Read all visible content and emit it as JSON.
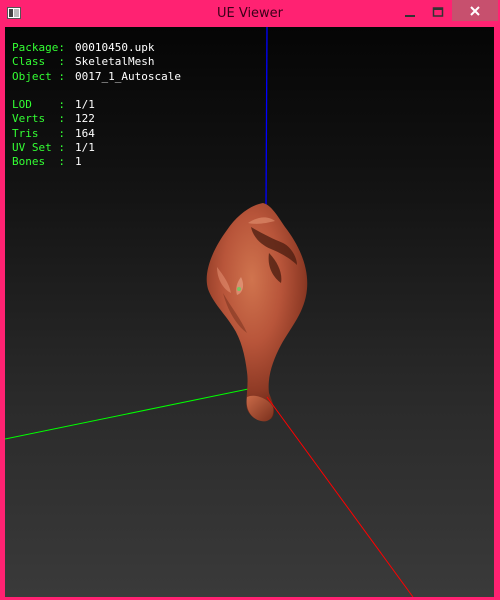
{
  "window": {
    "title": "UE Viewer",
    "colors": {
      "frame": "#ff2272",
      "close_button": "#c7506e"
    },
    "icons": {
      "app": "app-icon",
      "minimize": "minimize-icon",
      "maximize": "maximize-icon",
      "close": "close-icon"
    }
  },
  "info": {
    "package": {
      "label": "Package:",
      "value": "00010450.upk"
    },
    "class": {
      "label": "Class  :",
      "value": "SkeletalMesh"
    },
    "object": {
      "label": "Object :",
      "value": "0017_1_Autoscale"
    },
    "lod": {
      "label": "LOD    :",
      "value": "1/1"
    },
    "verts": {
      "label": "Verts  :",
      "value": "122"
    },
    "tris": {
      "label": "Tris   :",
      "value": "164"
    },
    "uvset": {
      "label": "UV Set :",
      "value": "1/1"
    },
    "bones": {
      "label": "Bones  :",
      "value": "1"
    }
  },
  "viewport": {
    "axis_colors": {
      "x": "#ff0000",
      "y": "#00ff00",
      "z": "#0000ff"
    },
    "text_colors": {
      "label": "#33ff33",
      "value": "#ffffff"
    }
  }
}
